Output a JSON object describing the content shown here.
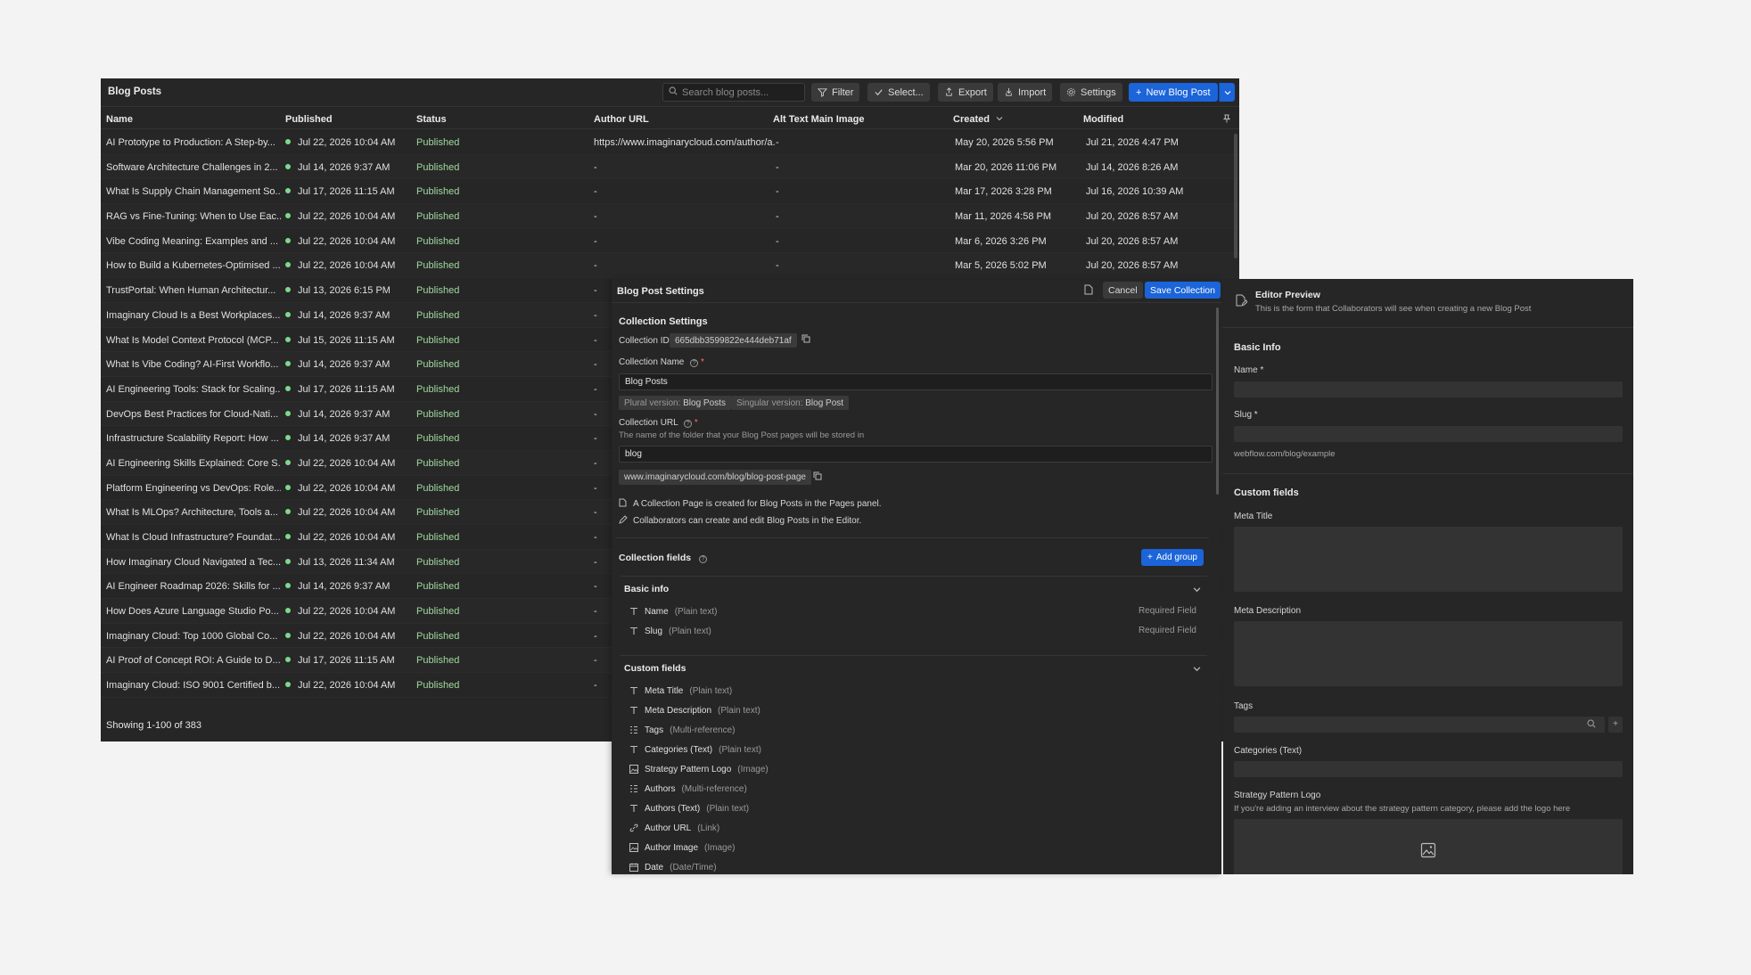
{
  "window": {
    "title": "Blog Posts"
  },
  "toolbar": {
    "search_placeholder": "Search blog posts...",
    "filter": "Filter",
    "select": "Select...",
    "export": "Export",
    "import": "Import",
    "settings": "Settings",
    "new_post": "New Blog Post"
  },
  "columns": [
    "Name",
    "Published",
    "Status",
    "Author URL",
    "Alt Text Main Image",
    "Created",
    "Modified"
  ],
  "rows": [
    {
      "name": "AI Prototype to Production: A Step-by...",
      "published": "Jul 22, 2026 10:04 AM",
      "status": "Published",
      "author_url": "https://www.imaginarycloud.com/author/a...",
      "alt": "-",
      "created": "May 20, 2026 5:56 PM",
      "modified": "Jul 21, 2026 4:47 PM"
    },
    {
      "name": "Software Architecture Challenges in 2...",
      "published": "Jul 14, 2026 9:37 AM",
      "status": "Published",
      "author_url": "-",
      "alt": "-",
      "created": "Mar 20, 2026 11:06 PM",
      "modified": "Jul 14, 2026 8:26 AM"
    },
    {
      "name": "What Is Supply Chain Management So...",
      "published": "Jul 17, 2026 11:15 AM",
      "status": "Published",
      "author_url": "-",
      "alt": "-",
      "created": "Mar 17, 2026 3:28 PM",
      "modified": "Jul 16, 2026 10:39 AM"
    },
    {
      "name": "RAG vs Fine-Tuning: When to Use Eac...",
      "published": "Jul 22, 2026 10:04 AM",
      "status": "Published",
      "author_url": "-",
      "alt": "-",
      "created": "Mar 11, 2026 4:58 PM",
      "modified": "Jul 20, 2026 8:57 AM"
    },
    {
      "name": "Vibe Coding Meaning: Examples and ...",
      "published": "Jul 22, 2026 10:04 AM",
      "status": "Published",
      "author_url": "-",
      "alt": "-",
      "created": "Mar 6, 2026 3:26 PM",
      "modified": "Jul 20, 2026 8:57 AM"
    },
    {
      "name": "How to Build a Kubernetes-Optimised ...",
      "published": "Jul 22, 2026 10:04 AM",
      "status": "Published",
      "author_url": "-",
      "alt": "-",
      "created": "Mar 5, 2026 5:02 PM",
      "modified": "Jul 20, 2026 8:57 AM"
    },
    {
      "name": "TrustPortal: When Human Architectur...",
      "published": "Jul 13, 2026 6:15 PM",
      "status": "Published",
      "author_url": "-",
      "alt": "",
      "created": "",
      "modified": ""
    },
    {
      "name": "Imaginary Cloud Is a Best Workplaces...",
      "published": "Jul 14, 2026 9:37 AM",
      "status": "Published",
      "author_url": "-",
      "alt": "",
      "created": "",
      "modified": ""
    },
    {
      "name": "What Is Model Context Protocol (MCP...",
      "published": "Jul 15, 2026 11:15 AM",
      "status": "Published",
      "author_url": "-",
      "alt": "",
      "created": "",
      "modified": ""
    },
    {
      "name": "What Is Vibe Coding? AI-First Workflo...",
      "published": "Jul 14, 2026 9:37 AM",
      "status": "Published",
      "author_url": "-",
      "alt": "",
      "created": "",
      "modified": ""
    },
    {
      "name": "AI Engineering Tools: Stack for Scaling...",
      "published": "Jul 17, 2026 11:15 AM",
      "status": "Published",
      "author_url": "-",
      "alt": "",
      "created": "",
      "modified": ""
    },
    {
      "name": "DevOps Best Practices for Cloud-Nati...",
      "published": "Jul 14, 2026 9:37 AM",
      "status": "Published",
      "author_url": "-",
      "alt": "",
      "created": "",
      "modified": ""
    },
    {
      "name": "Infrastructure Scalability Report: How ...",
      "published": "Jul 14, 2026 9:37 AM",
      "status": "Published",
      "author_url": "-",
      "alt": "",
      "created": "",
      "modified": ""
    },
    {
      "name": "AI Engineering Skills Explained: Core S...",
      "published": "Jul 22, 2026 10:04 AM",
      "status": "Published",
      "author_url": "-",
      "alt": "",
      "created": "",
      "modified": ""
    },
    {
      "name": "Platform Engineering vs DevOps: Role...",
      "published": "Jul 22, 2026 10:04 AM",
      "status": "Published",
      "author_url": "-",
      "alt": "",
      "created": "",
      "modified": ""
    },
    {
      "name": "What Is MLOps? Architecture, Tools a...",
      "published": "Jul 22, 2026 10:04 AM",
      "status": "Published",
      "author_url": "-",
      "alt": "",
      "created": "",
      "modified": ""
    },
    {
      "name": "What Is Cloud Infrastructure? Foundat...",
      "published": "Jul 22, 2026 10:04 AM",
      "status": "Published",
      "author_url": "-",
      "alt": "",
      "created": "",
      "modified": ""
    },
    {
      "name": "How Imaginary Cloud Navigated a Tec...",
      "published": "Jul 13, 2026 11:34 AM",
      "status": "Published",
      "author_url": "-",
      "alt": "",
      "created": "",
      "modified": ""
    },
    {
      "name": "AI Engineer Roadmap 2026: Skills for ...",
      "published": "Jul 14, 2026 9:37 AM",
      "status": "Published",
      "author_url": "-",
      "alt": "",
      "created": "",
      "modified": ""
    },
    {
      "name": "How Does Azure Language Studio Po...",
      "published": "Jul 22, 2026 10:04 AM",
      "status": "Published",
      "author_url": "-",
      "alt": "",
      "created": "",
      "modified": ""
    },
    {
      "name": "Imaginary Cloud: Top 1000 Global Co...",
      "published": "Jul 22, 2026 10:04 AM",
      "status": "Published",
      "author_url": "-",
      "alt": "",
      "created": "",
      "modified": ""
    },
    {
      "name": "AI Proof of Concept ROI: A Guide to D...",
      "published": "Jul 17, 2026 11:15 AM",
      "status": "Published",
      "author_url": "-",
      "alt": "",
      "created": "",
      "modified": ""
    },
    {
      "name": "Imaginary Cloud: ISO 9001 Certified b...",
      "published": "Jul 22, 2026 10:04 AM",
      "status": "Published",
      "author_url": "-",
      "alt": "",
      "created": "",
      "modified": ""
    }
  ],
  "footer": {
    "showing": "Showing 1-100 of 383"
  },
  "settings": {
    "title": "Blog Post Settings",
    "cancel": "Cancel",
    "save": "Save Collection",
    "section_title": "Collection Settings",
    "collection_id_label": "Collection ID",
    "collection_id": "665dbb3599822e444deb71af",
    "collection_name_label": "Collection Name",
    "collection_name": "Blog Posts",
    "plural_label": "Plural version:",
    "plural_value": "Blog Posts",
    "singular_label": "Singular version:",
    "singular_value": "Blog Post",
    "collection_url_label": "Collection URL",
    "collection_url_help": "The name of the folder that your Blog Post pages will be stored in",
    "collection_url": "blog",
    "url_preview": "www.imaginarycloud.com/blog/blog-post-page",
    "note_1": "A Collection Page is created for Blog Posts in the Pages panel.",
    "note_2": "Collaborators can create and edit Blog Posts in the Editor.",
    "fields_title": "Collection fields",
    "add_group": "Add group",
    "basic_group": "Basic info",
    "basic_fields": [
      {
        "name": "Name",
        "type": "(Plain text)",
        "note": "Required Field",
        "icon": "text-icon"
      },
      {
        "name": "Slug",
        "type": "(Plain text)",
        "note": "Required Field",
        "icon": "text-icon"
      }
    ],
    "custom_group": "Custom fields",
    "custom_fields": [
      {
        "name": "Meta Title",
        "type": "(Plain text)",
        "icon": "text-icon"
      },
      {
        "name": "Meta Description",
        "type": "(Plain text)",
        "icon": "text-icon"
      },
      {
        "name": "Tags",
        "type": "(Multi-reference)",
        "icon": "multi-reference-icon"
      },
      {
        "name": "Categories (Text)",
        "type": "(Plain text)",
        "icon": "text-icon"
      },
      {
        "name": "Strategy Pattern Logo",
        "type": "(Image)",
        "icon": "image-icon"
      },
      {
        "name": "Authors",
        "type": "(Multi-reference)",
        "icon": "multi-reference-icon"
      },
      {
        "name": "Authors (Text)",
        "type": "(Plain text)",
        "icon": "text-icon"
      },
      {
        "name": "Author URL",
        "type": "(Link)",
        "icon": "link-icon"
      },
      {
        "name": "Author Image",
        "type": "(Image)",
        "icon": "image-icon"
      },
      {
        "name": "Date",
        "type": "(Date/Time)",
        "icon": "calendar-icon"
      }
    ]
  },
  "preview": {
    "title": "Editor Preview",
    "subtitle": "This is the form that Collaborators will see when creating a new Blog Post",
    "basic_info": "Basic Info",
    "name_label": "Name *",
    "slug_label": "Slug *",
    "slug_hint": "webflow.com/blog/example",
    "custom_fields": "Custom fields",
    "meta_title": "Meta Title",
    "meta_description": "Meta Description",
    "tags": "Tags",
    "tags_add": "+",
    "categories": "Categories (Text)",
    "strategy_logo": "Strategy Pattern Logo",
    "strategy_logo_help": "If you're adding an interview about the strategy pattern category, please add the logo here"
  },
  "colors": {
    "accent": "#1b64d9",
    "published_dot": "#7fd88a",
    "panel_bg": "#262626",
    "page_bg": "#f3f3f4"
  }
}
